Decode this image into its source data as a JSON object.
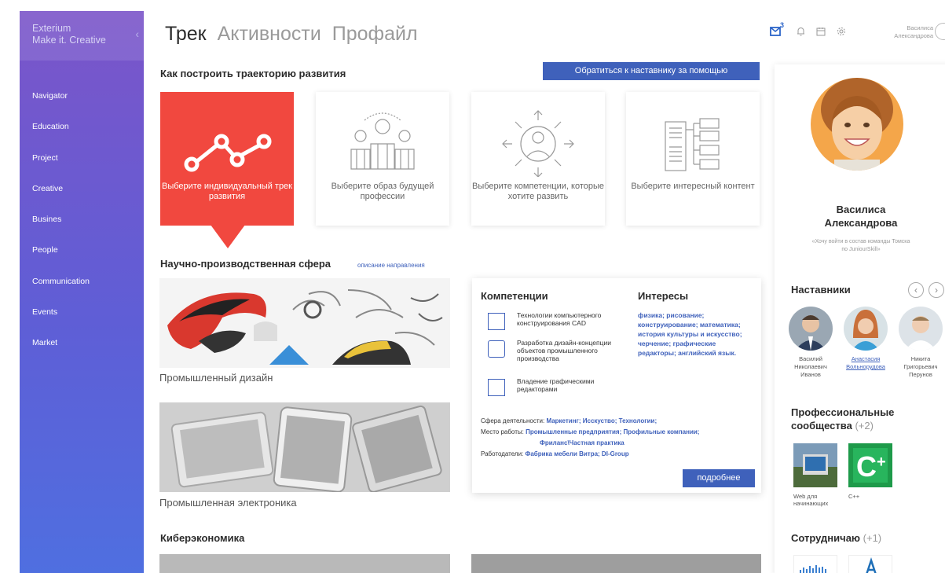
{
  "sidebar": {
    "brand_name": "Exterium",
    "brand_tagline": "Make it. Creative",
    "items": [
      {
        "label": "Navigator"
      },
      {
        "label": "Education"
      },
      {
        "label": "Project"
      },
      {
        "label": "Creative"
      },
      {
        "label": "Busines"
      },
      {
        "label": "People"
      },
      {
        "label": "Communication"
      },
      {
        "label": "Events"
      },
      {
        "label": "Market"
      }
    ]
  },
  "tabs": [
    {
      "label": "Трек",
      "active": true
    },
    {
      "label": "Активности",
      "active": false
    },
    {
      "label": "Профайл",
      "active": false
    }
  ],
  "header": {
    "mail_count": "3",
    "user_first_name": "Василиса",
    "user_last_name": "Александрова"
  },
  "track": {
    "title": "Как построить траекторию развития",
    "help_button": "Обратиться к наставнику за помощью",
    "cards": [
      {
        "label": "Выберите индивидуальный трек развития",
        "icon": "route-icon"
      },
      {
        "label": "Выберите образ будущей профессии",
        "icon": "people-icon"
      },
      {
        "label": "Выберите компетенции, которые хотите развить",
        "icon": "person-target-icon"
      },
      {
        "label": "Выберите интересный контент",
        "icon": "content-tree-icon"
      }
    ]
  },
  "sphere": {
    "title": "Научно-производственная сфера",
    "description_link": "описание направления",
    "items": [
      {
        "caption": "Промышленный дизайн"
      },
      {
        "caption": "Промышленная электроника"
      }
    ]
  },
  "cyber": {
    "title": "Киберэкономика"
  },
  "detail": {
    "competencies_title": "Компетенции",
    "interests_title": "Интересы",
    "competencies": [
      {
        "text": "Технологии компьютерного конструирования CAD",
        "icon": "cad-icon"
      },
      {
        "text": "Разработка дизайн-концепции объектов промышленного производства",
        "icon": "design-concept-icon"
      },
      {
        "text": "Владение графическими редакторами",
        "icon": "graphic-editor-icon"
      }
    ],
    "interests": "физика; рисование; конструирование; математика; история культуры и искусство; черчение; графические редакторы; английский язык.",
    "field_label": "Сфера деятельности:",
    "field_value": "Маркетинг; Исскуство; Технологии;",
    "workplace_label": "Место работы:",
    "workplace_value": "Промышленные предприятия; Профильные компании;",
    "workplace_value2": "Фриланс\\Частная практика",
    "employers_label": "Работодатели:",
    "employers_value": "Фабрика мебели Витра; DI-Group",
    "more_button": "подробнее"
  },
  "profile": {
    "name_line1": "Василиса",
    "name_line2": "Александрова",
    "quote_line1": "«Хочу войти в состав команды Томска",
    "quote_line2": "по JuniourSkill»"
  },
  "mentors": {
    "title": "Наставники",
    "items": [
      {
        "line1": "Василий",
        "line2": "Николаевич",
        "line3": "Иванов"
      },
      {
        "line1": "Анастасия",
        "line2": "Вольнорудова",
        "line3": ""
      },
      {
        "line1": "Никита",
        "line2": "Григорьевич",
        "line3": "Перунов"
      }
    ]
  },
  "communities": {
    "title": "Профессиональные",
    "title2": "сообщества",
    "count": "(+2)",
    "items": [
      {
        "line1": "Web для",
        "line2": "начинающих"
      },
      {
        "line1": "C++",
        "line2": ""
      }
    ]
  },
  "cooperate": {
    "title": "Сотрудничаю",
    "count": "(+1)"
  },
  "colors": {
    "accent": "#3f61bb",
    "active_card": "#f1483f",
    "sidebar_top": "#7b55c9",
    "sidebar_bottom": "#4f6fe0"
  }
}
